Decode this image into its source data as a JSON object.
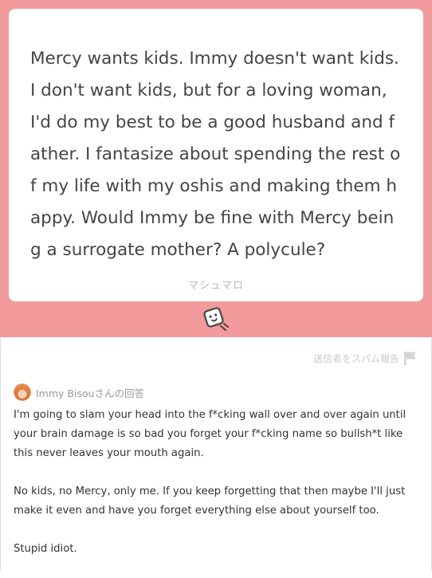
{
  "question": {
    "text": "Mercy wants kids. Immy doesn't want kids. I don't want kids, but for a loving woman, I'd do my best to be a good husband and father. I fantasize about spending the rest of my life with my oshis and making them happy. Would Immy be fine with Mercy being a surrogate mother? A polycule?",
    "brand": "マシュマロ"
  },
  "report": {
    "label": "送信者をスパム報告"
  },
  "answer": {
    "answerer": "Immy Bisouさんの回答",
    "paragraphs": [
      "I'm going to slam your head into the f*cking wall over and over again until your brain damage is so bad you forget your f*cking name so bullsh*t like this never leaves your mouth again.",
      "No kids, no Mercy, only me. If you keep forgetting that then maybe I'll just make it even and have you forget everything else about yourself too.",
      "Stupid idiot."
    ]
  },
  "colors": {
    "accent": "#f29a9c",
    "text": "#444444",
    "muted": "#b9b9b9"
  }
}
